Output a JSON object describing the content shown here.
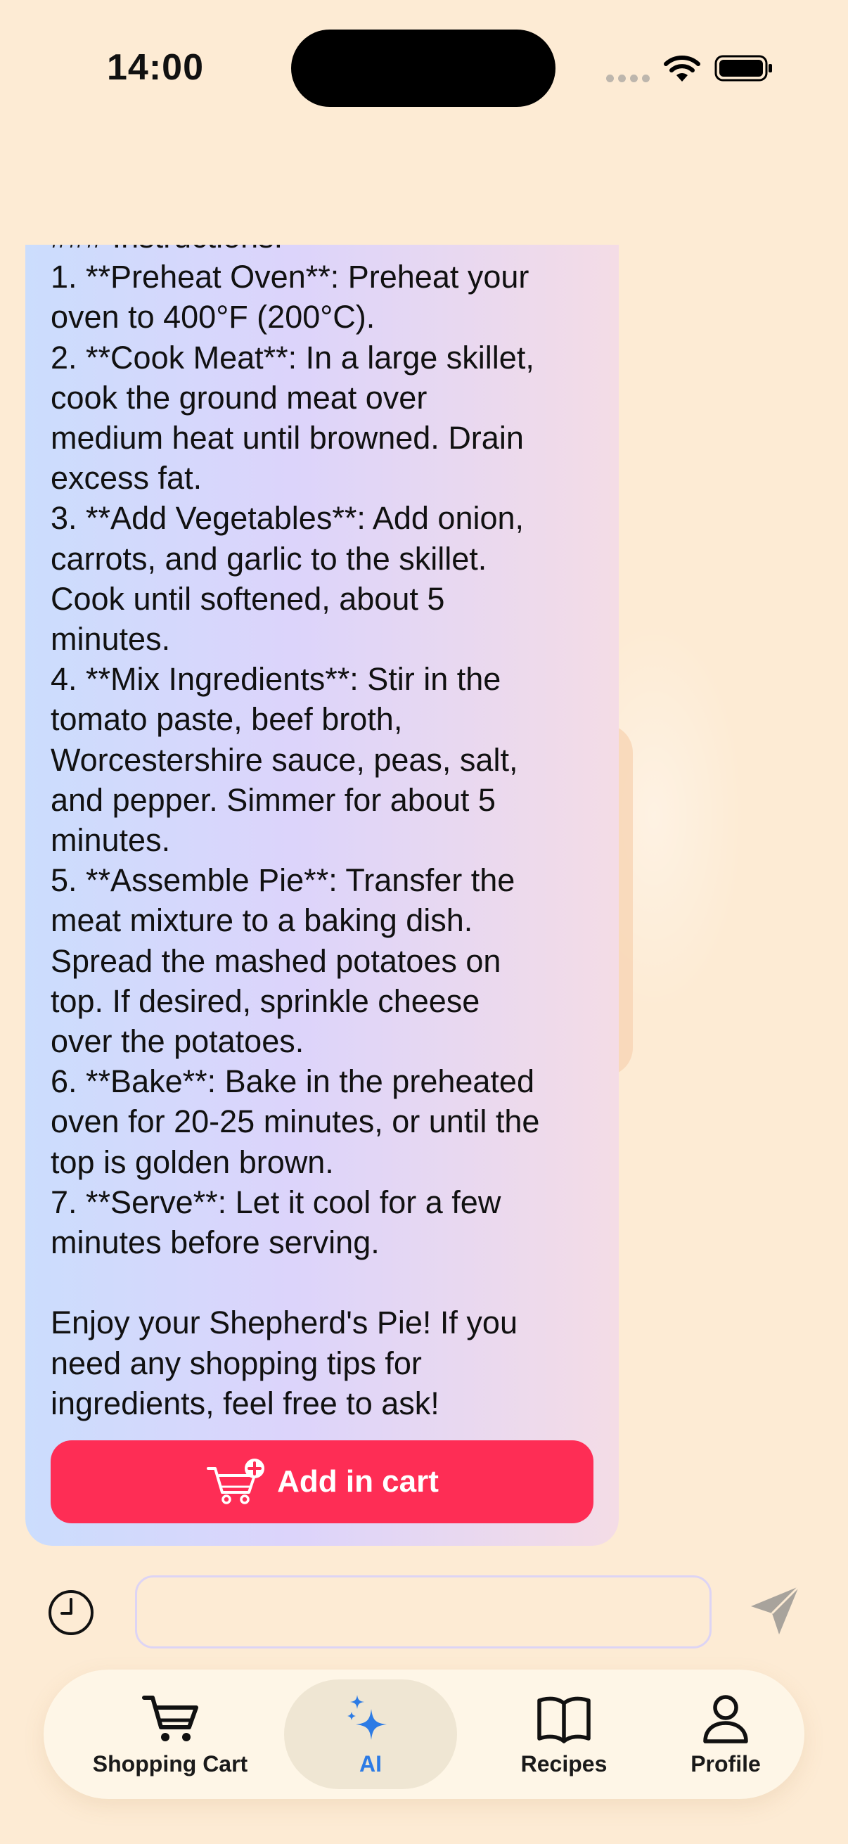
{
  "status_bar": {
    "time": "14:00"
  },
  "chat": {
    "message_lines": [
      "### Instructions:",
      "1. **Preheat Oven**: Preheat your",
      "oven to 400°F (200°C).",
      "2. **Cook Meat**: In a large skillet,",
      "cook the ground meat over",
      "medium heat until browned. Drain",
      "excess fat.",
      "3. **Add Vegetables**: Add onion,",
      "carrots, and garlic to the skillet.",
      "Cook until softened, about 5",
      "minutes.",
      "4. **Mix Ingredients**: Stir in the",
      "tomato paste, beef broth,",
      "Worcestershire sauce, peas, salt,",
      "and pepper. Simmer for about 5",
      "minutes.",
      "5. **Assemble Pie**: Transfer the",
      "meat mixture to a baking dish.",
      "Spread the mashed potatoes on",
      "top. If desired, sprinkle cheese",
      "over the potatoes.",
      "6. **Bake**: Bake in the preheated",
      "oven for 20-25 minutes, or until the",
      "top is golden brown.",
      "7. **Serve**: Let it cool for a few",
      "minutes before serving.",
      "",
      "Enjoy your Shepherd's Pie! If you",
      "need any shopping tips for",
      "ingredients, feel free to ask!"
    ],
    "add_cart_label": "Add in cart"
  },
  "input": {
    "value": "",
    "placeholder": ""
  },
  "tabs": [
    {
      "label": "Shopping Cart",
      "icon": "cart-icon",
      "active": false
    },
    {
      "label": "AI",
      "icon": "sparkles-icon",
      "active": true
    },
    {
      "label": "Recipes",
      "icon": "book-icon",
      "active": false
    },
    {
      "label": "Profile",
      "icon": "person-icon",
      "active": false
    }
  ],
  "colors": {
    "background": "#FDEBD4",
    "accent": "#FE2D55",
    "active_tab": "#2C7BE5"
  }
}
